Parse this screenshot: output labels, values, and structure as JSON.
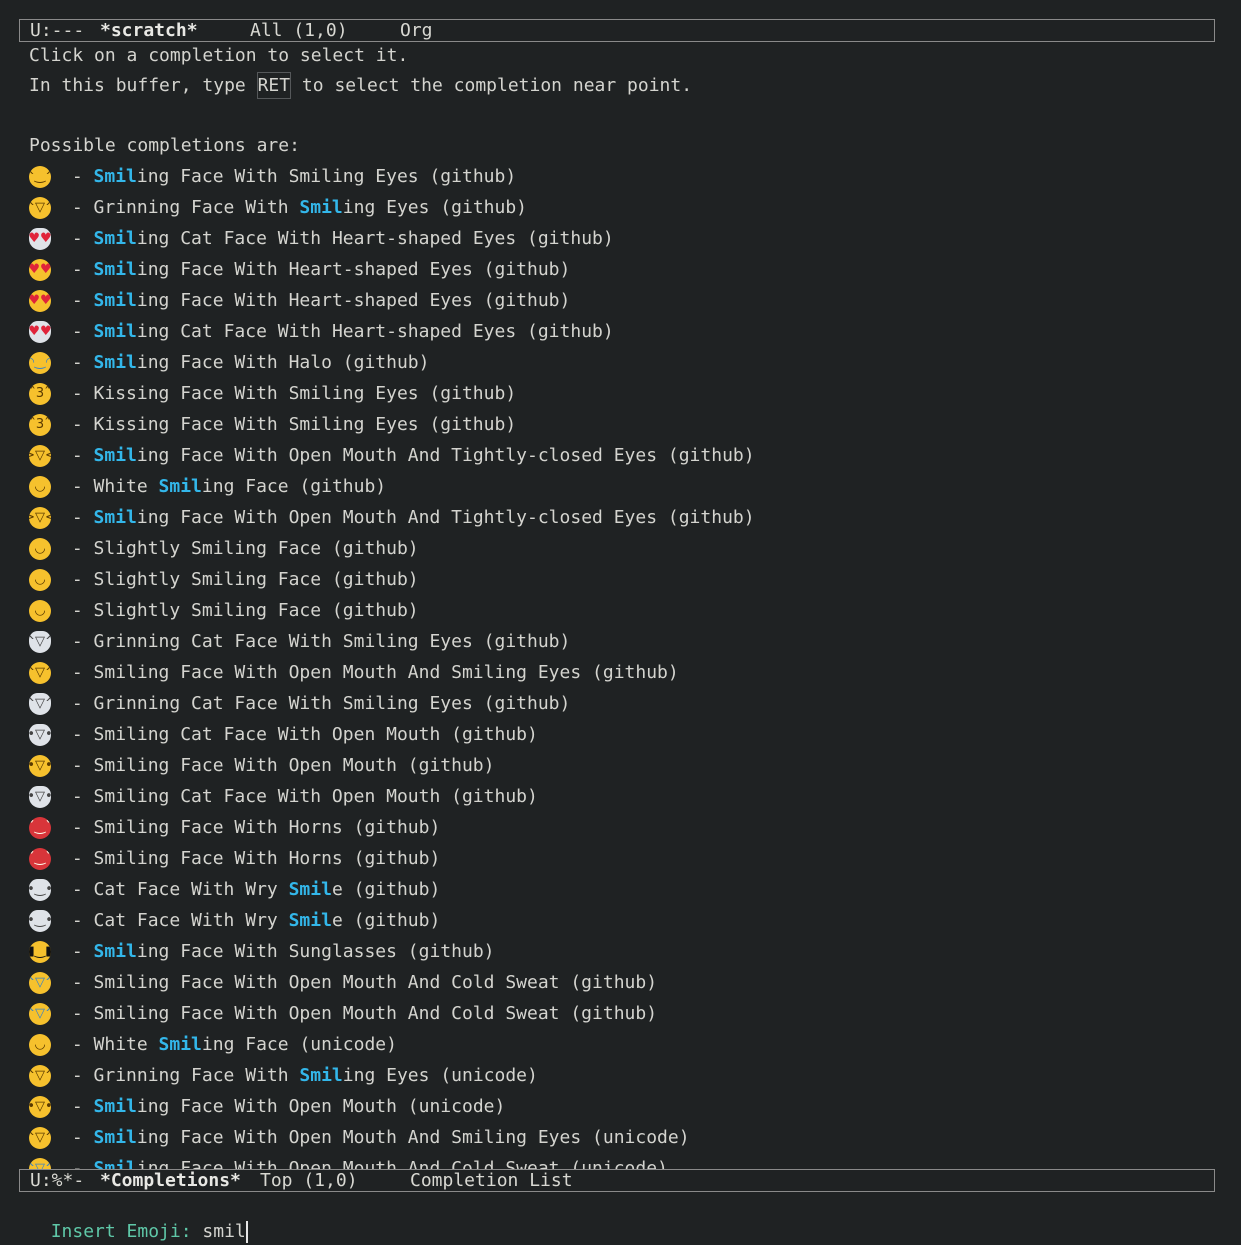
{
  "top_modeline": {
    "status": "U:---",
    "buffer": "*scratch*",
    "position": "All (1,0)",
    "mode": "Org"
  },
  "help": {
    "line1": "Click on a completion to select it.",
    "line2_pre": "In this buffer, type ",
    "line2_key": "RET",
    "line2_post": " to select the completion near point.",
    "line3": "Possible completions are:"
  },
  "completions": [
    {
      "icon": "smiling-face-with-smiling-eyes-icon",
      "glyph": "^‿^",
      "style": "",
      "pre": "",
      "match": "Smil",
      "post": "ing Face With Smiling Eyes (github)"
    },
    {
      "icon": "grinning-face-with-smiling-eyes-icon",
      "glyph": "^▽^",
      "style": "",
      "pre": "Grinning Face With ",
      "match": "Smil",
      "post": "ing Eyes (github)"
    },
    {
      "icon": "cat-face-heart-eyes-icon",
      "glyph": "♥♥",
      "style": "catheart",
      "pre": "",
      "match": "Smil",
      "post": "ing Cat Face With Heart-shaped Eyes (github)"
    },
    {
      "icon": "face-heart-eyes-icon",
      "glyph": "♥♥",
      "style": "heart",
      "pre": "",
      "match": "Smil",
      "post": "ing Face With Heart-shaped Eyes (github)"
    },
    {
      "icon": "face-heart-eyes-icon",
      "glyph": "♥♥",
      "style": "heart",
      "pre": "",
      "match": "Smil",
      "post": "ing Face With Heart-shaped Eyes (github)"
    },
    {
      "icon": "cat-face-heart-eyes-icon",
      "glyph": "♥♥",
      "style": "catheart",
      "pre": "",
      "match": "Smil",
      "post": "ing Cat Face With Heart-shaped Eyes (github)"
    },
    {
      "icon": "face-with-halo-icon",
      "glyph": "◠‿◠",
      "style": "halo",
      "pre": "",
      "match": "Smil",
      "post": "ing Face With Halo (github)"
    },
    {
      "icon": "kissing-face-icon",
      "glyph": "ˆ3ˆ",
      "style": "",
      "pre": "Kissing Face With Smiling Eyes (github)",
      "match": "",
      "post": ""
    },
    {
      "icon": "kissing-face-icon",
      "glyph": "ˆ3ˆ",
      "style": "",
      "pre": "Kissing Face With Smiling Eyes (github)",
      "match": "",
      "post": ""
    },
    {
      "icon": "laughing-face-icon",
      "glyph": "&gt;▽&lt;",
      "style": "",
      "pre": "",
      "match": "Smil",
      "post": "ing Face With Open Mouth And Tightly-closed Eyes (github)"
    },
    {
      "icon": "white-smiling-face-icon",
      "glyph": "◡",
      "style": "",
      "pre": "White ",
      "match": "Smil",
      "post": "ing Face (github)"
    },
    {
      "icon": "laughing-face-icon",
      "glyph": "&gt;▽&lt;",
      "style": "",
      "pre": "",
      "match": "Smil",
      "post": "ing Face With Open Mouth And Tightly-closed Eyes (github)"
    },
    {
      "icon": "slightly-smiling-face-icon",
      "glyph": "◡",
      "style": "",
      "pre": "Slightly Smiling Face (github)",
      "match": "",
      "post": ""
    },
    {
      "icon": "slightly-smiling-face-icon",
      "glyph": "◡",
      "style": "",
      "pre": "Slightly Smiling Face (github)",
      "match": "",
      "post": ""
    },
    {
      "icon": "slightly-smiling-face-icon",
      "glyph": "◡",
      "style": "",
      "pre": "Slightly Smiling Face (github)",
      "match": "",
      "post": ""
    },
    {
      "icon": "grinning-cat-face-icon",
      "glyph": "^▽^",
      "style": "cat",
      "pre": "Grinning Cat Face With Smiling Eyes (github)",
      "match": "",
      "post": ""
    },
    {
      "icon": "smiling-face-open-mouth-smiling-eyes-icon",
      "glyph": "^▽^",
      "style": "",
      "pre": "Smiling Face With Open Mouth And Smiling Eyes (github)",
      "match": "",
      "post": ""
    },
    {
      "icon": "grinning-cat-face-icon",
      "glyph": "^▽^",
      "style": "cat",
      "pre": "Grinning Cat Face With Smiling Eyes (github)",
      "match": "",
      "post": ""
    },
    {
      "icon": "smiling-cat-face-open-mouth-icon",
      "glyph": "•▽•",
      "style": "cat",
      "pre": "Smiling Cat Face With Open Mouth (github)",
      "match": "",
      "post": ""
    },
    {
      "icon": "smiling-face-open-mouth-icon",
      "glyph": "•▽•",
      "style": "",
      "pre": "Smiling Face With Open Mouth (github)",
      "match": "",
      "post": ""
    },
    {
      "icon": "smiling-cat-face-open-mouth-icon",
      "glyph": "•▽•",
      "style": "cat",
      "pre": "Smiling Cat Face With Open Mouth (github)",
      "match": "",
      "post": ""
    },
    {
      "icon": "smiling-face-with-horns-icon",
      "glyph": "ˇ‿ˇ",
      "style": "devil",
      "pre": "Smiling Face With Horns (github)",
      "match": "",
      "post": ""
    },
    {
      "icon": "smiling-face-with-horns-icon",
      "glyph": "ˇ‿ˇ",
      "style": "devil",
      "pre": "Smiling Face With Horns (github)",
      "match": "",
      "post": ""
    },
    {
      "icon": "cat-face-wry-smile-icon",
      "glyph": "•‿•",
      "style": "cat",
      "pre": "Cat Face With Wry ",
      "match": "Smil",
      "post": "e (github)"
    },
    {
      "icon": "cat-face-wry-smile-icon",
      "glyph": "•‿•",
      "style": "cat",
      "pre": "Cat Face With Wry ",
      "match": "Smil",
      "post": "e (github)"
    },
    {
      "icon": "smiling-face-with-sunglasses-icon",
      "glyph": "■‿■",
      "style": "sunglasses",
      "pre": "",
      "match": "Smil",
      "post": "ing Face With Sunglasses (github)"
    },
    {
      "icon": "smiling-face-cold-sweat-icon",
      "glyph": "^▽^",
      "style": "sweat",
      "pre": "Smiling Face With Open Mouth And Cold Sweat (github)",
      "match": "",
      "post": ""
    },
    {
      "icon": "smiling-face-cold-sweat-icon",
      "glyph": "^▽^",
      "style": "sweat",
      "pre": "Smiling Face With Open Mouth And Cold Sweat (github)",
      "match": "",
      "post": ""
    },
    {
      "icon": "white-smiling-face-icon",
      "glyph": "◡",
      "style": "",
      "pre": "White ",
      "match": "Smil",
      "post": "ing Face (unicode)"
    },
    {
      "icon": "grinning-face-with-smiling-eyes-icon",
      "glyph": "^▽^",
      "style": "",
      "pre": "Grinning Face With ",
      "match": "Smil",
      "post": "ing Eyes (unicode)"
    },
    {
      "icon": "smiling-face-open-mouth-icon",
      "glyph": "•▽•",
      "style": "",
      "pre": "",
      "match": "Smil",
      "post": "ing Face With Open Mouth (unicode)"
    },
    {
      "icon": "smiling-face-open-mouth-smiling-eyes-icon",
      "glyph": "^▽^",
      "style": "",
      "pre": "",
      "match": "Smil",
      "post": "ing Face With Open Mouth And Smiling Eyes (unicode)"
    },
    {
      "icon": "smiling-face-cold-sweat-icon",
      "glyph": "^▽^",
      "style": "sweat",
      "pre": "",
      "match": "Smil",
      "post": "ing Face With Open Mouth And Cold Sweat (unicode)"
    }
  ],
  "separator": " - ",
  "bottom_modeline": {
    "status": "U:%*-",
    "buffer": "*Completions*",
    "position": "Top (1,0)",
    "mode": "Completion List"
  },
  "minibuffer": {
    "prompt": "Insert Emoji: ",
    "input": "smil"
  },
  "colors": {
    "background": "#1f2223",
    "foreground": "#d4d4cf",
    "match": "#33b7ea",
    "prompt": "#5fc8a8"
  }
}
